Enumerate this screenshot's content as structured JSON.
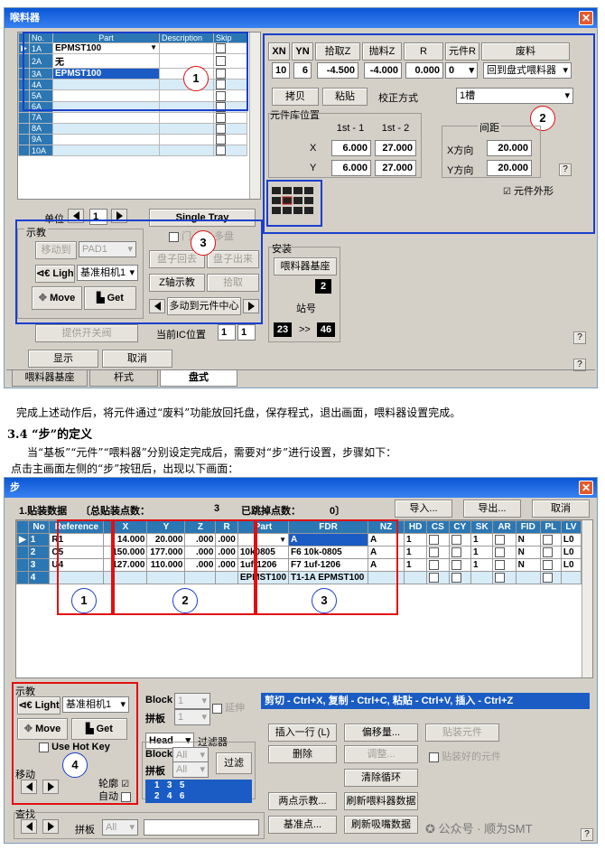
{
  "w1": {
    "title": "喉料器",
    "grid": {
      "headers": [
        "No.",
        "Part",
        "Description",
        "Skip"
      ],
      "rows": [
        {
          "no": "1A",
          "part": "EPMST100"
        },
        {
          "no": "2A",
          "part": "无"
        },
        {
          "no": "3A",
          "part": "EPMST100"
        },
        {
          "no": "4A",
          "part": ""
        },
        {
          "no": "5A",
          "part": ""
        },
        {
          "no": "6A",
          "part": ""
        },
        {
          "no": "7A",
          "part": ""
        },
        {
          "no": "8A",
          "part": ""
        },
        {
          "no": "9A",
          "part": ""
        },
        {
          "no": "10A",
          "part": ""
        }
      ]
    },
    "unit_label": "单位",
    "unit_value": "1",
    "single_tray": "Single Tray",
    "teach": {
      "legend": "示教",
      "move_to": "移动到",
      "pad": "PAD1",
      "light": "Light",
      "camera": "基准相机1",
      "move": "Move",
      "get": "Get",
      "valve": "提供开关阀"
    },
    "mid": {
      "chk_label": "门",
      "multi_tray": "多盘",
      "tray_back": "盘子回去",
      "tray_out": "盘子出来",
      "z_teach": "Z轴示教",
      "pick": "拾取",
      "move_center": "多动到元件中心",
      "current_ic": "当前IC位置",
      "ic1": "1",
      "ic2": "1"
    },
    "right": {
      "headers": [
        "XN",
        "YN",
        "拾取Z",
        "抛料Z",
        "R",
        "元件R",
        "废料"
      ],
      "values": [
        "10",
        "6",
        "-4.500",
        "-4.000",
        "0.000",
        "0",
        "回到盘式喂料器"
      ],
      "copy": "拷贝",
      "paste": "粘贴",
      "calib_label": "校正方式",
      "calib_value": "1槽",
      "lib_pos": "元件库位置",
      "col1": "1st - 1",
      "col2": "1st - 2",
      "spacing": "间距",
      "x": "X",
      "y": "Y",
      "x1": "6.000",
      "x2": "27.000",
      "y1": "6.000",
      "y2": "27.000",
      "xdir": "X方向",
      "ydir": "Y方向",
      "xs": "20.000",
      "ys": "20.000",
      "outline": "元件外形",
      "help": "?"
    },
    "install": {
      "title": "安装",
      "base": "喂料器基座",
      "base_val": "2",
      "station": "站号",
      "st1": "23",
      "arrow": ">>",
      "st2": "46"
    },
    "display": "显示",
    "cancel": "取消",
    "tabs": [
      "喂料器基座",
      "杆式",
      "盘式"
    ],
    "callouts": [
      "1",
      "2",
      "3"
    ]
  },
  "doc": {
    "line1": "完成上述动作后，将元件通过“废料”功能放回托盘，保存程式，退出画面，喂料器设置完成。",
    "heading": "3.4 “步”的定义",
    "line2": "当“基板”“元件”“喂料器”分别设定完成后，需要对“步”进行设置，步骤如下：",
    "line3": "点击主画面左侧的“步”按钮后，出现以下画面："
  },
  "w2": {
    "title": "步",
    "summary": "1.贴装数据",
    "total_label": "〔总贴装点数：",
    "total": "3",
    "skipped_label": "已跳掉点数：",
    "skipped": "0〕",
    "import": "导入...",
    "export": "导出...",
    "cancel": "取消",
    "headers": [
      "No",
      "Reference",
      "X",
      "Y",
      "Z",
      "R",
      "Part",
      "FDR",
      "NZ",
      "HD",
      "CS",
      "CY",
      "SK",
      "AR",
      "FID",
      "PL",
      "LV"
    ],
    "rows": [
      {
        "no": "1",
        "ref": "R1",
        "x": "14.000",
        "y": "20.000",
        "z": ".000",
        "r": ".000",
        "part": "",
        "fdr": "A",
        "nz": "A",
        "hd": "1",
        "sk": "1",
        "fid": "N",
        "lv": "L0"
      },
      {
        "no": "2",
        "ref": "C5",
        "x": "150.000",
        "y": "177.000",
        "z": ".000",
        "r": ".000",
        "part": "10k0805",
        "fdr": "F6 10k-0805",
        "nz": "A",
        "hd": "1",
        "sk": "1",
        "fid": "N",
        "lv": "L0"
      },
      {
        "no": "3",
        "ref": "U4",
        "x": "127.000",
        "y": "110.000",
        "z": ".000",
        "r": ".000",
        "part": "1uf-1206",
        "fdr": "F7 1uf-1206",
        "nz": "A",
        "hd": "1",
        "sk": "1",
        "fid": "N",
        "lv": "L0"
      },
      {
        "no": "4",
        "ref": "",
        "x": "",
        "y": "",
        "z": "",
        "r": "",
        "part": "EPMST100",
        "fdr": "T1-1A EPMST100",
        "nz": "",
        "hd": "",
        "sk": "",
        "fid": "",
        "lv": ""
      }
    ],
    "teach": "示教",
    "light": "Light",
    "camera": "基准相机1",
    "move": "Move",
    "get": "Get",
    "hotkey": "Use Hot Key",
    "move_label": "移动",
    "outline": "轮廓",
    "auto": "自动",
    "find": "查找",
    "board": "拼板",
    "board_val": "All",
    "block": "Block",
    "block_val": "1",
    "pinban": "拼板",
    "pinban_val": "1",
    "extend": "延伸",
    "head": "Head",
    "filter": "过滤器",
    "fblock": "Block",
    "fblock_val": "All",
    "fpinban": "拼板",
    "fpinban_val": "All",
    "filter_btn": "过滤",
    "list": [
      "1",
      "3",
      "5",
      "2",
      "4",
      "6"
    ],
    "shortcut": "剪切 - Ctrl+X, 复制 - Ctrl+C, 粘贴 - Ctrl+V, 插入 - Ctrl+Z",
    "insert": "插入一行 (L)",
    "offset": "偏移量...",
    "place": "贴装元件",
    "delete": "删除",
    "adjust": "调整...",
    "placed": "贴装好的元件",
    "clear": "清除循环",
    "twopoint": "两点示教...",
    "refresh_feeder": "刷新喂料器数据",
    "reference": "基准点...",
    "refresh_nozzle": "刷新吸嘴数据",
    "help": "?",
    "callouts": [
      "1",
      "2",
      "3",
      "4"
    ],
    "watermark": "公众号 · 顺为SMT"
  }
}
